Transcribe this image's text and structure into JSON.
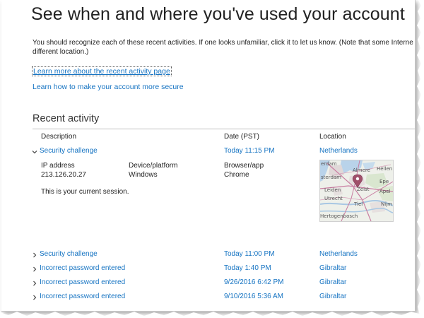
{
  "page": {
    "title": "See when and where you've used your account",
    "intro_line1": "You should recognize each of these recent activities. If one looks unfamiliar, click it to let us know. (Note that some Interne",
    "intro_line2": "different location.)",
    "learn_more_activity": "Learn more about the recent activity page",
    "learn_more_secure": "Learn how to make your account more secure"
  },
  "recent": {
    "heading": "Recent activity",
    "columns": {
      "description": "Description",
      "date": "Date (PST)",
      "location": "Location"
    },
    "expanded": {
      "description": "Security challenge",
      "date": "Today 11:15 PM",
      "location": "Netherlands",
      "ip_label": "IP address",
      "ip_value": "213.126.20.27",
      "device_label": "Device/platform",
      "device_value": "Windows",
      "browser_label": "Browser/app",
      "browser_value": "Chrome",
      "session_note": "This is your current session.",
      "map_labels": {
        "almere": "Almere",
        "hellen": "Hellen",
        "rdam": "erdam",
        "amsterdam": "sterdam",
        "epe": "Epe",
        "leiden": "Leiden",
        "zeist": "Zeist",
        "apeld": "Apel",
        "utrecht": "Utrecht",
        "tiel": "Tiel",
        "hertogenbosch": "Hertogenbosch",
        "nijmegen": "Nijm"
      }
    },
    "rows": [
      {
        "description": "Security challenge",
        "date": "Today 11:00 PM",
        "location": "Netherlands"
      },
      {
        "description": "Incorrect password entered",
        "date": "Today 1:40 PM",
        "location": "Gibraltar"
      },
      {
        "description": "Incorrect password entered",
        "date": "9/26/2016 6:42 PM",
        "location": "Gibraltar"
      },
      {
        "description": "Incorrect password entered",
        "date": "9/10/2016 5:36 AM",
        "location": "Gibraltar"
      }
    ]
  },
  "icons": {
    "expanded_chevron": "chevron-down-icon",
    "collapsed_chevron": "chevron-right-icon",
    "map_pin": "map-pin-icon"
  },
  "colors": {
    "link": "#1573c2",
    "text": "#222222",
    "divider": "#bfbfbf",
    "pin": "#a0506a"
  }
}
